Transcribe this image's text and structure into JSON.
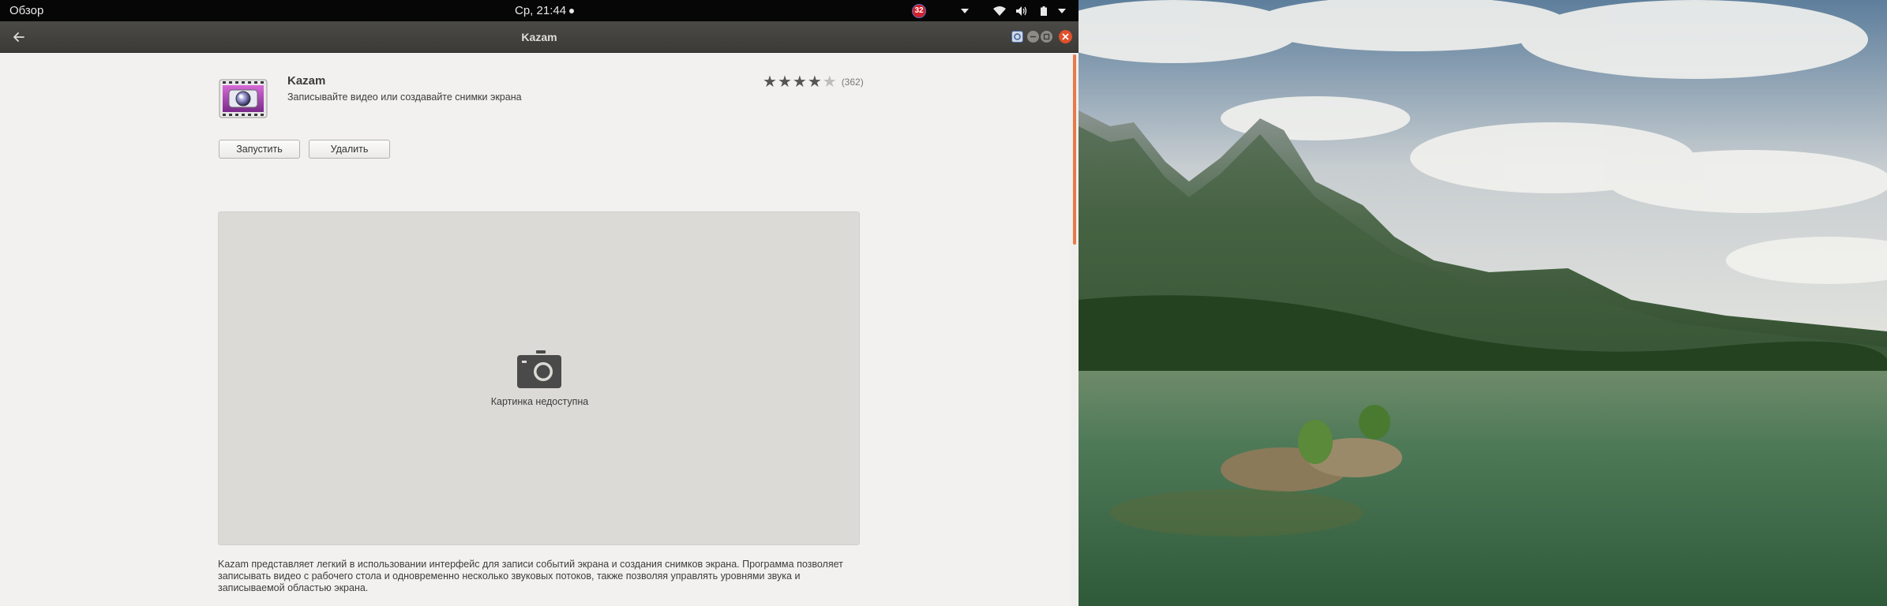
{
  "top_panel": {
    "activities": "Обзор",
    "clock": "Ср, 21:44",
    "notification_count": "32"
  },
  "window": {
    "title": "Kazam"
  },
  "app": {
    "name": "Kazam",
    "summary": "Записывайте видео или создавайте снимки экрана",
    "rating_stars": 4,
    "rating_max": 5,
    "rating_count": "(362)",
    "launch_label": "Запустить",
    "remove_label": "Удалить",
    "screenshot_unavailable": "Картинка недоступна",
    "description_lines": [
      "Kazam представляет легкий в использовании интерфейс для записи событий экрана и создания снимков экрана. Программа позволяет",
      "записывать видео с рабочего стола и одновременно несколько звуковых потоков, также позволяя управлять уровнями звука и",
      "записываемой областью экрана."
    ]
  },
  "colors": {
    "accent_orange": "#e77a4a",
    "close_button": "#e0502a",
    "headerbar": "#3f3e3a"
  }
}
